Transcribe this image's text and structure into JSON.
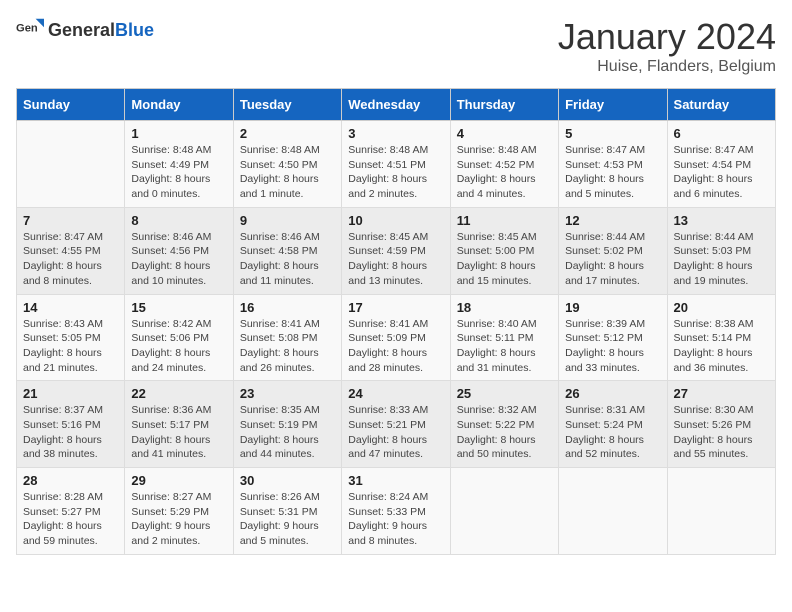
{
  "header": {
    "logo_general": "General",
    "logo_blue": "Blue",
    "month": "January 2024",
    "location": "Huise, Flanders, Belgium"
  },
  "days_of_week": [
    "Sunday",
    "Monday",
    "Tuesday",
    "Wednesday",
    "Thursday",
    "Friday",
    "Saturday"
  ],
  "weeks": [
    [
      {
        "day": "",
        "info": ""
      },
      {
        "day": "1",
        "info": "Sunrise: 8:48 AM\nSunset: 4:49 PM\nDaylight: 8 hours\nand 0 minutes."
      },
      {
        "day": "2",
        "info": "Sunrise: 8:48 AM\nSunset: 4:50 PM\nDaylight: 8 hours\nand 1 minute."
      },
      {
        "day": "3",
        "info": "Sunrise: 8:48 AM\nSunset: 4:51 PM\nDaylight: 8 hours\nand 2 minutes."
      },
      {
        "day": "4",
        "info": "Sunrise: 8:48 AM\nSunset: 4:52 PM\nDaylight: 8 hours\nand 4 minutes."
      },
      {
        "day": "5",
        "info": "Sunrise: 8:47 AM\nSunset: 4:53 PM\nDaylight: 8 hours\nand 5 minutes."
      },
      {
        "day": "6",
        "info": "Sunrise: 8:47 AM\nSunset: 4:54 PM\nDaylight: 8 hours\nand 6 minutes."
      }
    ],
    [
      {
        "day": "7",
        "info": "Sunrise: 8:47 AM\nSunset: 4:55 PM\nDaylight: 8 hours\nand 8 minutes."
      },
      {
        "day": "8",
        "info": "Sunrise: 8:46 AM\nSunset: 4:56 PM\nDaylight: 8 hours\nand 10 minutes."
      },
      {
        "day": "9",
        "info": "Sunrise: 8:46 AM\nSunset: 4:58 PM\nDaylight: 8 hours\nand 11 minutes."
      },
      {
        "day": "10",
        "info": "Sunrise: 8:45 AM\nSunset: 4:59 PM\nDaylight: 8 hours\nand 13 minutes."
      },
      {
        "day": "11",
        "info": "Sunrise: 8:45 AM\nSunset: 5:00 PM\nDaylight: 8 hours\nand 15 minutes."
      },
      {
        "day": "12",
        "info": "Sunrise: 8:44 AM\nSunset: 5:02 PM\nDaylight: 8 hours\nand 17 minutes."
      },
      {
        "day": "13",
        "info": "Sunrise: 8:44 AM\nSunset: 5:03 PM\nDaylight: 8 hours\nand 19 minutes."
      }
    ],
    [
      {
        "day": "14",
        "info": "Sunrise: 8:43 AM\nSunset: 5:05 PM\nDaylight: 8 hours\nand 21 minutes."
      },
      {
        "day": "15",
        "info": "Sunrise: 8:42 AM\nSunset: 5:06 PM\nDaylight: 8 hours\nand 24 minutes."
      },
      {
        "day": "16",
        "info": "Sunrise: 8:41 AM\nSunset: 5:08 PM\nDaylight: 8 hours\nand 26 minutes."
      },
      {
        "day": "17",
        "info": "Sunrise: 8:41 AM\nSunset: 5:09 PM\nDaylight: 8 hours\nand 28 minutes."
      },
      {
        "day": "18",
        "info": "Sunrise: 8:40 AM\nSunset: 5:11 PM\nDaylight: 8 hours\nand 31 minutes."
      },
      {
        "day": "19",
        "info": "Sunrise: 8:39 AM\nSunset: 5:12 PM\nDaylight: 8 hours\nand 33 minutes."
      },
      {
        "day": "20",
        "info": "Sunrise: 8:38 AM\nSunset: 5:14 PM\nDaylight: 8 hours\nand 36 minutes."
      }
    ],
    [
      {
        "day": "21",
        "info": "Sunrise: 8:37 AM\nSunset: 5:16 PM\nDaylight: 8 hours\nand 38 minutes."
      },
      {
        "day": "22",
        "info": "Sunrise: 8:36 AM\nSunset: 5:17 PM\nDaylight: 8 hours\nand 41 minutes."
      },
      {
        "day": "23",
        "info": "Sunrise: 8:35 AM\nSunset: 5:19 PM\nDaylight: 8 hours\nand 44 minutes."
      },
      {
        "day": "24",
        "info": "Sunrise: 8:33 AM\nSunset: 5:21 PM\nDaylight: 8 hours\nand 47 minutes."
      },
      {
        "day": "25",
        "info": "Sunrise: 8:32 AM\nSunset: 5:22 PM\nDaylight: 8 hours\nand 50 minutes."
      },
      {
        "day": "26",
        "info": "Sunrise: 8:31 AM\nSunset: 5:24 PM\nDaylight: 8 hours\nand 52 minutes."
      },
      {
        "day": "27",
        "info": "Sunrise: 8:30 AM\nSunset: 5:26 PM\nDaylight: 8 hours\nand 55 minutes."
      }
    ],
    [
      {
        "day": "28",
        "info": "Sunrise: 8:28 AM\nSunset: 5:27 PM\nDaylight: 8 hours\nand 59 minutes."
      },
      {
        "day": "29",
        "info": "Sunrise: 8:27 AM\nSunset: 5:29 PM\nDaylight: 9 hours\nand 2 minutes."
      },
      {
        "day": "30",
        "info": "Sunrise: 8:26 AM\nSunset: 5:31 PM\nDaylight: 9 hours\nand 5 minutes."
      },
      {
        "day": "31",
        "info": "Sunrise: 8:24 AM\nSunset: 5:33 PM\nDaylight: 9 hours\nand 8 minutes."
      },
      {
        "day": "",
        "info": ""
      },
      {
        "day": "",
        "info": ""
      },
      {
        "day": "",
        "info": ""
      }
    ]
  ]
}
